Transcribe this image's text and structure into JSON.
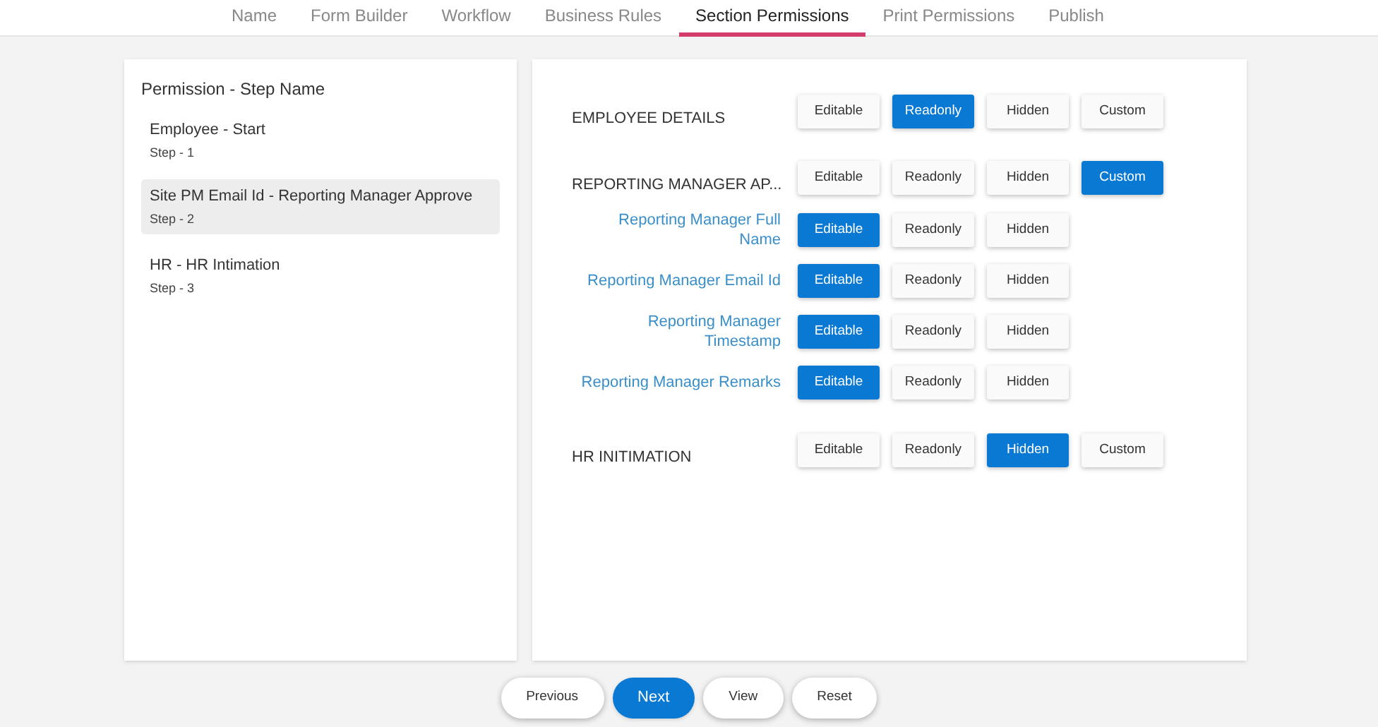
{
  "tabs": [
    {
      "label": "Name",
      "selected": false
    },
    {
      "label": "Form Builder",
      "selected": false
    },
    {
      "label": "Workflow",
      "selected": false
    },
    {
      "label": "Business Rules",
      "selected": false
    },
    {
      "label": "Section Permissions",
      "selected": true
    },
    {
      "label": "Print Permissions",
      "selected": false
    },
    {
      "label": "Publish",
      "selected": false
    }
  ],
  "steps_panel": {
    "title": "Permission - Step Name",
    "steps": [
      {
        "name": "Employee - Start",
        "step": "Step - 1",
        "selected": false
      },
      {
        "name": "Site PM Email Id - Reporting Manager Approve",
        "step": "Step - 2",
        "selected": true
      },
      {
        "name": "HR - HR Intimation",
        "step": "Step - 3",
        "selected": false
      }
    ]
  },
  "permissions": [
    {
      "kind": "section",
      "label": "EMPLOYEE DETAILS",
      "options": [
        {
          "label": "Editable",
          "selected": false
        },
        {
          "label": "Readonly",
          "selected": true
        },
        {
          "label": "Hidden",
          "selected": false
        },
        {
          "label": "Custom",
          "selected": false
        }
      ]
    },
    {
      "kind": "section",
      "label": "REPORTING MANAGER AP...",
      "options": [
        {
          "label": "Editable",
          "selected": false
        },
        {
          "label": "Readonly",
          "selected": false
        },
        {
          "label": "Hidden",
          "selected": false
        },
        {
          "label": "Custom",
          "selected": true
        }
      ]
    },
    {
      "kind": "field",
      "label": "Reporting Manager Full Name",
      "options": [
        {
          "label": "Editable",
          "selected": true
        },
        {
          "label": "Readonly",
          "selected": false
        },
        {
          "label": "Hidden",
          "selected": false
        }
      ]
    },
    {
      "kind": "field",
      "label": "Reporting Manager Email Id",
      "options": [
        {
          "label": "Editable",
          "selected": true
        },
        {
          "label": "Readonly",
          "selected": false
        },
        {
          "label": "Hidden",
          "selected": false
        }
      ]
    },
    {
      "kind": "field",
      "label": "Reporting Manager Timestamp",
      "options": [
        {
          "label": "Editable",
          "selected": true
        },
        {
          "label": "Readonly",
          "selected": false
        },
        {
          "label": "Hidden",
          "selected": false
        }
      ]
    },
    {
      "kind": "field",
      "label": "Reporting Manager Remarks",
      "options": [
        {
          "label": "Editable",
          "selected": true
        },
        {
          "label": "Readonly",
          "selected": false
        },
        {
          "label": "Hidden",
          "selected": false
        }
      ]
    },
    {
      "kind": "section",
      "label": "HR INITIMATION",
      "options": [
        {
          "label": "Editable",
          "selected": false
        },
        {
          "label": "Readonly",
          "selected": false
        },
        {
          "label": "Hidden",
          "selected": true
        },
        {
          "label": "Custom",
          "selected": false
        }
      ]
    }
  ],
  "footer_buttons": [
    {
      "label": "Previous",
      "kind": "default"
    },
    {
      "label": "Next",
      "kind": "primary"
    },
    {
      "label": "View",
      "kind": "default"
    },
    {
      "label": "Reset",
      "kind": "default"
    }
  ]
}
